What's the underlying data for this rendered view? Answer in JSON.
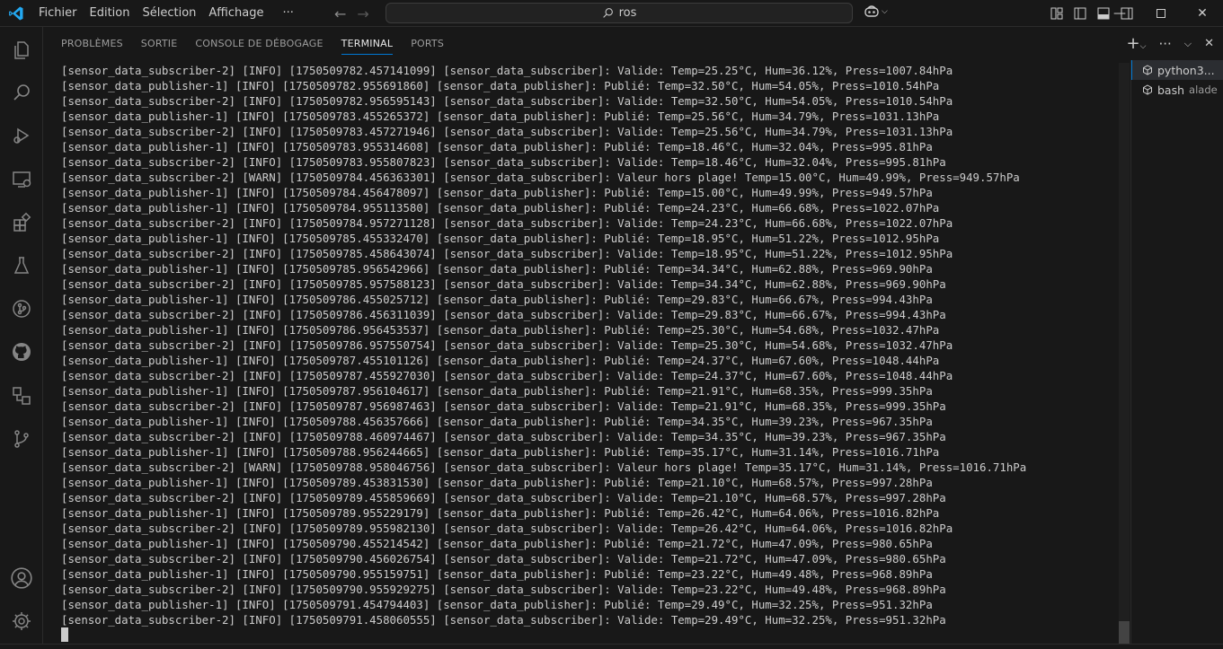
{
  "titlebar": {
    "menu": [
      "Fichier",
      "Edition",
      "Sélection",
      "Affichage"
    ],
    "more_label": "···",
    "search_text": "ros",
    "colors": {
      "accent": "#0078d4",
      "logo": "#23a9f2"
    }
  },
  "activity": [
    "explorer-icon",
    "search-icon",
    "run-debug-icon",
    "remote-explorer-icon",
    "extensions-icon",
    "testing-icon",
    "source-control-icon",
    "github-icon",
    "containers-icon",
    "git-graph-icon",
    "account-icon",
    "settings-gear-icon"
  ],
  "panel": {
    "tabs": [
      "PROBLÈMES",
      "SORTIE",
      "CONSOLE DE DÉBOGAGE",
      "TERMINAL",
      "PORTS"
    ],
    "active_tab": "TERMINAL"
  },
  "terminal": {
    "lines": [
      "[sensor_data_subscriber-2] [INFO] [1750509782.457141099] [sensor_data_subscriber]: Valide: Temp=25.25°C, Hum=36.12%, Press=1007.84hPa",
      "[sensor_data_publisher-1] [INFO] [1750509782.955691860] [sensor_data_publisher]: Publié: Temp=32.50°C, Hum=54.05%, Press=1010.54hPa",
      "[sensor_data_subscriber-2] [INFO] [1750509782.956595143] [sensor_data_subscriber]: Valide: Temp=32.50°C, Hum=54.05%, Press=1010.54hPa",
      "[sensor_data_publisher-1] [INFO] [1750509783.455265372] [sensor_data_publisher]: Publié: Temp=25.56°C, Hum=34.79%, Press=1031.13hPa",
      "[sensor_data_subscriber-2] [INFO] [1750509783.457271946] [sensor_data_subscriber]: Valide: Temp=25.56°C, Hum=34.79%, Press=1031.13hPa",
      "[sensor_data_publisher-1] [INFO] [1750509783.955314608] [sensor_data_publisher]: Publié: Temp=18.46°C, Hum=32.04%, Press=995.81hPa",
      "[sensor_data_subscriber-2] [INFO] [1750509783.955807823] [sensor_data_subscriber]: Valide: Temp=18.46°C, Hum=32.04%, Press=995.81hPa",
      "[sensor_data_subscriber-2] [WARN] [1750509784.456363301] [sensor_data_subscriber]: Valeur hors plage! Temp=15.00°C, Hum=49.99%, Press=949.57hPa",
      "[sensor_data_publisher-1] [INFO] [1750509784.456478097] [sensor_data_publisher]: Publié: Temp=15.00°C, Hum=49.99%, Press=949.57hPa",
      "[sensor_data_publisher-1] [INFO] [1750509784.955113580] [sensor_data_publisher]: Publié: Temp=24.23°C, Hum=66.68%, Press=1022.07hPa",
      "[sensor_data_subscriber-2] [INFO] [1750509784.957271128] [sensor_data_subscriber]: Valide: Temp=24.23°C, Hum=66.68%, Press=1022.07hPa",
      "[sensor_data_publisher-1] [INFO] [1750509785.455332470] [sensor_data_publisher]: Publié: Temp=18.95°C, Hum=51.22%, Press=1012.95hPa",
      "[sensor_data_subscriber-2] [INFO] [1750509785.458643074] [sensor_data_subscriber]: Valide: Temp=18.95°C, Hum=51.22%, Press=1012.95hPa",
      "[sensor_data_publisher-1] [INFO] [1750509785.956542966] [sensor_data_publisher]: Publié: Temp=34.34°C, Hum=62.88%, Press=969.90hPa",
      "[sensor_data_subscriber-2] [INFO] [1750509785.957588123] [sensor_data_subscriber]: Valide: Temp=34.34°C, Hum=62.88%, Press=969.90hPa",
      "[sensor_data_publisher-1] [INFO] [1750509786.455025712] [sensor_data_publisher]: Publié: Temp=29.83°C, Hum=66.67%, Press=994.43hPa",
      "[sensor_data_subscriber-2] [INFO] [1750509786.456311039] [sensor_data_subscriber]: Valide: Temp=29.83°C, Hum=66.67%, Press=994.43hPa",
      "[sensor_data_publisher-1] [INFO] [1750509786.956453537] [sensor_data_publisher]: Publié: Temp=25.30°C, Hum=54.68%, Press=1032.47hPa",
      "[sensor_data_subscriber-2] [INFO] [1750509786.957550754] [sensor_data_subscriber]: Valide: Temp=25.30°C, Hum=54.68%, Press=1032.47hPa",
      "[sensor_data_publisher-1] [INFO] [1750509787.455101126] [sensor_data_publisher]: Publié: Temp=24.37°C, Hum=67.60%, Press=1048.44hPa",
      "[sensor_data_subscriber-2] [INFO] [1750509787.455927030] [sensor_data_subscriber]: Valide: Temp=24.37°C, Hum=67.60%, Press=1048.44hPa",
      "[sensor_data_publisher-1] [INFO] [1750509787.956104617] [sensor_data_publisher]: Publié: Temp=21.91°C, Hum=68.35%, Press=999.35hPa",
      "[sensor_data_subscriber-2] [INFO] [1750509787.956987463] [sensor_data_subscriber]: Valide: Temp=21.91°C, Hum=68.35%, Press=999.35hPa",
      "[sensor_data_publisher-1] [INFO] [1750509788.456357666] [sensor_data_publisher]: Publié: Temp=34.35°C, Hum=39.23%, Press=967.35hPa",
      "[sensor_data_subscriber-2] [INFO] [1750509788.460974467] [sensor_data_subscriber]: Valide: Temp=34.35°C, Hum=39.23%, Press=967.35hPa",
      "[sensor_data_publisher-1] [INFO] [1750509788.956244665] [sensor_data_publisher]: Publié: Temp=35.17°C, Hum=31.14%, Press=1016.71hPa",
      "[sensor_data_subscriber-2] [WARN] [1750509788.958046756] [sensor_data_subscriber]: Valeur hors plage! Temp=35.17°C, Hum=31.14%, Press=1016.71hPa",
      "[sensor_data_publisher-1] [INFO] [1750509789.453831530] [sensor_data_publisher]: Publié: Temp=21.10°C, Hum=68.57%, Press=997.28hPa",
      "[sensor_data_subscriber-2] [INFO] [1750509789.455859669] [sensor_data_subscriber]: Valide: Temp=21.10°C, Hum=68.57%, Press=997.28hPa",
      "[sensor_data_publisher-1] [INFO] [1750509789.955229179] [sensor_data_publisher]: Publié: Temp=26.42°C, Hum=64.06%, Press=1016.82hPa",
      "[sensor_data_subscriber-2] [INFO] [1750509789.955982130] [sensor_data_subscriber]: Valide: Temp=26.42°C, Hum=64.06%, Press=1016.82hPa",
      "[sensor_data_publisher-1] [INFO] [1750509790.455214542] [sensor_data_publisher]: Publié: Temp=21.72°C, Hum=47.09%, Press=980.65hPa",
      "[sensor_data_subscriber-2] [INFO] [1750509790.456026754] [sensor_data_subscriber]: Valide: Temp=21.72°C, Hum=47.09%, Press=980.65hPa",
      "[sensor_data_publisher-1] [INFO] [1750509790.955159751] [sensor_data_publisher]: Publié: Temp=23.22°C, Hum=49.48%, Press=968.89hPa",
      "[sensor_data_subscriber-2] [INFO] [1750509790.955929275] [sensor_data_subscriber]: Valide: Temp=23.22°C, Hum=49.48%, Press=968.89hPa",
      "[sensor_data_publisher-1] [INFO] [1750509791.454794403] [sensor_data_publisher]: Publié: Temp=29.49°C, Hum=32.25%, Press=951.32hPa",
      "[sensor_data_subscriber-2] [INFO] [1750509791.458060555] [sensor_data_subscriber]: Valide: Temp=29.49°C, Hum=32.25%, Press=951.32hPa"
    ]
  },
  "terminal_list": [
    {
      "name": "python3...",
      "sub": "",
      "active": true
    },
    {
      "name": "bash",
      "sub": "alade",
      "active": false
    }
  ]
}
